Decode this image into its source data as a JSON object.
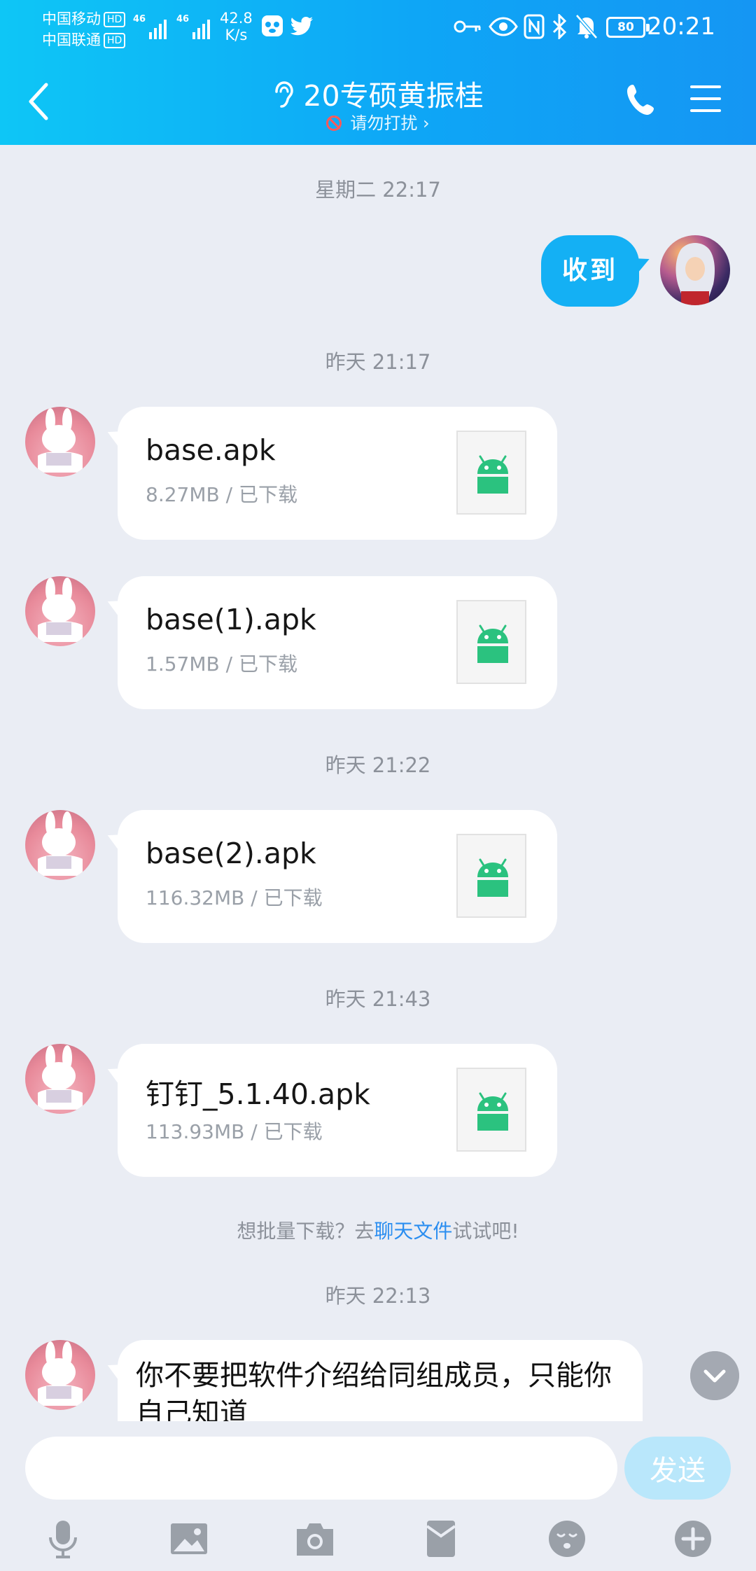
{
  "status_bar": {
    "carrier1": "中国移动",
    "carrier2": "中国联通",
    "hd": "HD",
    "sig1_label": "46",
    "sig2_label": "46",
    "speed_value": "42.8",
    "speed_unit": "K/s",
    "battery": "80",
    "time": "20:21"
  },
  "header": {
    "title": "20专硕黄振桂",
    "subtitle": "请勿打扰 ›",
    "icons": [
      "back-arrow-icon",
      "ear-icon",
      "phone-icon",
      "menu-icon"
    ]
  },
  "chat": {
    "ts1": "星期二 22:17",
    "sent_text": "收到",
    "ts2": "昨天 21:17",
    "files": [
      {
        "name": "base.apk",
        "meta": "8.27MB / 已下载"
      },
      {
        "name": "base(1).apk",
        "meta": "1.57MB / 已下载"
      },
      {
        "name": "base(2).apk",
        "meta": "116.32MB / 已下载"
      },
      {
        "name": "钉钉_5.1.40.apk",
        "meta": "113.93MB / 已下载"
      }
    ],
    "ts3": "昨天 21:22",
    "ts4": "昨天 21:43",
    "hint_pre": "想批量下载？去",
    "hint_link": "聊天文件",
    "hint_post": "试试吧!",
    "ts5": "昨天 22:13",
    "last_message": "你不要把软件介绍给同组成员，只能你自己知道"
  },
  "input": {
    "value": "",
    "send_label": "发送",
    "tools": [
      "microphone-icon",
      "image-icon",
      "camera-icon",
      "red-packet-icon",
      "emoji-icon",
      "plus-icon"
    ]
  },
  "colors": {
    "header_start": "#0ec6f6",
    "header_end": "#1596f3",
    "bubble_sent": "#14b0f4",
    "background": "#eaedf4",
    "android_green": "#2bc27f",
    "link": "#2b8ef0"
  }
}
